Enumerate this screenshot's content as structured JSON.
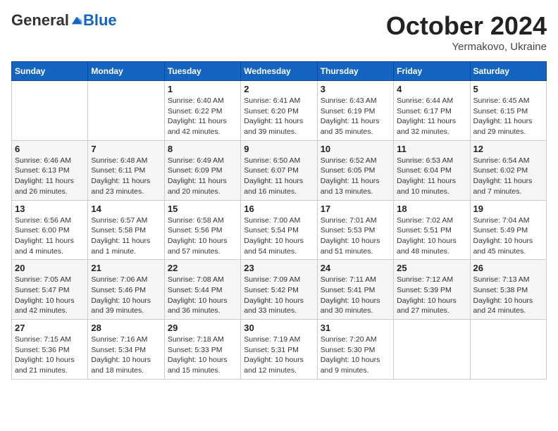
{
  "header": {
    "logo_general": "General",
    "logo_blue": "Blue",
    "month_title": "October 2024",
    "subtitle": "Yermakovo, Ukraine"
  },
  "days_of_week": [
    "Sunday",
    "Monday",
    "Tuesday",
    "Wednesday",
    "Thursday",
    "Friday",
    "Saturday"
  ],
  "weeks": [
    [
      {
        "day": "",
        "info": ""
      },
      {
        "day": "",
        "info": ""
      },
      {
        "day": "1",
        "info": "Sunrise: 6:40 AM\nSunset: 6:22 PM\nDaylight: 11 hours and 42 minutes."
      },
      {
        "day": "2",
        "info": "Sunrise: 6:41 AM\nSunset: 6:20 PM\nDaylight: 11 hours and 39 minutes."
      },
      {
        "day": "3",
        "info": "Sunrise: 6:43 AM\nSunset: 6:19 PM\nDaylight: 11 hours and 35 minutes."
      },
      {
        "day": "4",
        "info": "Sunrise: 6:44 AM\nSunset: 6:17 PM\nDaylight: 11 hours and 32 minutes."
      },
      {
        "day": "5",
        "info": "Sunrise: 6:45 AM\nSunset: 6:15 PM\nDaylight: 11 hours and 29 minutes."
      }
    ],
    [
      {
        "day": "6",
        "info": "Sunrise: 6:46 AM\nSunset: 6:13 PM\nDaylight: 11 hours and 26 minutes."
      },
      {
        "day": "7",
        "info": "Sunrise: 6:48 AM\nSunset: 6:11 PM\nDaylight: 11 hours and 23 minutes."
      },
      {
        "day": "8",
        "info": "Sunrise: 6:49 AM\nSunset: 6:09 PM\nDaylight: 11 hours and 20 minutes."
      },
      {
        "day": "9",
        "info": "Sunrise: 6:50 AM\nSunset: 6:07 PM\nDaylight: 11 hours and 16 minutes."
      },
      {
        "day": "10",
        "info": "Sunrise: 6:52 AM\nSunset: 6:05 PM\nDaylight: 11 hours and 13 minutes."
      },
      {
        "day": "11",
        "info": "Sunrise: 6:53 AM\nSunset: 6:04 PM\nDaylight: 11 hours and 10 minutes."
      },
      {
        "day": "12",
        "info": "Sunrise: 6:54 AM\nSunset: 6:02 PM\nDaylight: 11 hours and 7 minutes."
      }
    ],
    [
      {
        "day": "13",
        "info": "Sunrise: 6:56 AM\nSunset: 6:00 PM\nDaylight: 11 hours and 4 minutes."
      },
      {
        "day": "14",
        "info": "Sunrise: 6:57 AM\nSunset: 5:58 PM\nDaylight: 11 hours and 1 minute."
      },
      {
        "day": "15",
        "info": "Sunrise: 6:58 AM\nSunset: 5:56 PM\nDaylight: 10 hours and 57 minutes."
      },
      {
        "day": "16",
        "info": "Sunrise: 7:00 AM\nSunset: 5:54 PM\nDaylight: 10 hours and 54 minutes."
      },
      {
        "day": "17",
        "info": "Sunrise: 7:01 AM\nSunset: 5:53 PM\nDaylight: 10 hours and 51 minutes."
      },
      {
        "day": "18",
        "info": "Sunrise: 7:02 AM\nSunset: 5:51 PM\nDaylight: 10 hours and 48 minutes."
      },
      {
        "day": "19",
        "info": "Sunrise: 7:04 AM\nSunset: 5:49 PM\nDaylight: 10 hours and 45 minutes."
      }
    ],
    [
      {
        "day": "20",
        "info": "Sunrise: 7:05 AM\nSunset: 5:47 PM\nDaylight: 10 hours and 42 minutes."
      },
      {
        "day": "21",
        "info": "Sunrise: 7:06 AM\nSunset: 5:46 PM\nDaylight: 10 hours and 39 minutes."
      },
      {
        "day": "22",
        "info": "Sunrise: 7:08 AM\nSunset: 5:44 PM\nDaylight: 10 hours and 36 minutes."
      },
      {
        "day": "23",
        "info": "Sunrise: 7:09 AM\nSunset: 5:42 PM\nDaylight: 10 hours and 33 minutes."
      },
      {
        "day": "24",
        "info": "Sunrise: 7:11 AM\nSunset: 5:41 PM\nDaylight: 10 hours and 30 minutes."
      },
      {
        "day": "25",
        "info": "Sunrise: 7:12 AM\nSunset: 5:39 PM\nDaylight: 10 hours and 27 minutes."
      },
      {
        "day": "26",
        "info": "Sunrise: 7:13 AM\nSunset: 5:38 PM\nDaylight: 10 hours and 24 minutes."
      }
    ],
    [
      {
        "day": "27",
        "info": "Sunrise: 7:15 AM\nSunset: 5:36 PM\nDaylight: 10 hours and 21 minutes."
      },
      {
        "day": "28",
        "info": "Sunrise: 7:16 AM\nSunset: 5:34 PM\nDaylight: 10 hours and 18 minutes."
      },
      {
        "day": "29",
        "info": "Sunrise: 7:18 AM\nSunset: 5:33 PM\nDaylight: 10 hours and 15 minutes."
      },
      {
        "day": "30",
        "info": "Sunrise: 7:19 AM\nSunset: 5:31 PM\nDaylight: 10 hours and 12 minutes."
      },
      {
        "day": "31",
        "info": "Sunrise: 7:20 AM\nSunset: 5:30 PM\nDaylight: 10 hours and 9 minutes."
      },
      {
        "day": "",
        "info": ""
      },
      {
        "day": "",
        "info": ""
      }
    ]
  ]
}
